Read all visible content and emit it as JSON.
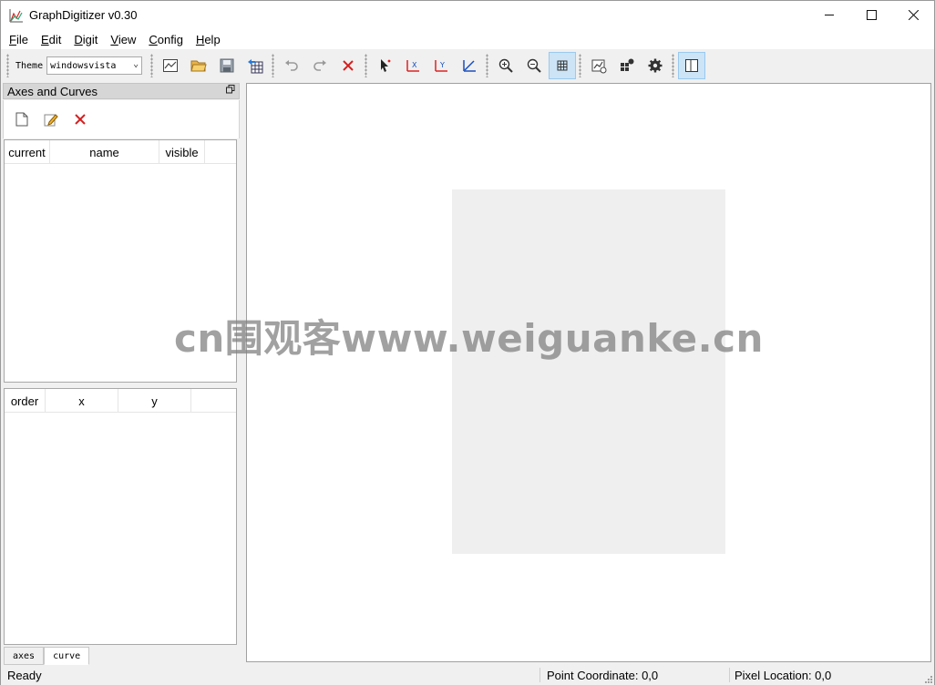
{
  "window": {
    "title": "GraphDigitizer v0.30",
    "controls": {
      "minimize": "—",
      "maximize": "☐",
      "close": "✕"
    }
  },
  "menu": {
    "items": [
      {
        "label": "File",
        "mnemonic": "F",
        "rest": "ile"
      },
      {
        "label": "Edit",
        "mnemonic": "E",
        "rest": "dit"
      },
      {
        "label": "Digit",
        "mnemonic": "D",
        "rest": "igit"
      },
      {
        "label": "View",
        "mnemonic": "V",
        "rest": "iew"
      },
      {
        "label": "Config",
        "mnemonic": "C",
        "rest": "onfig"
      },
      {
        "label": "Help",
        "mnemonic": "H",
        "rest": "elp"
      }
    ]
  },
  "toolbar": {
    "theme_label": "Theme",
    "theme_value": "windowsvista",
    "buttons": [
      {
        "icon": "graph-new-icon"
      },
      {
        "icon": "folder-open-icon"
      },
      {
        "icon": "save-icon"
      },
      {
        "icon": "export-table-icon"
      },
      {
        "icon": "undo-icon"
      },
      {
        "icon": "redo-icon"
      },
      {
        "icon": "delete-icon"
      },
      {
        "icon": "select-pointer-icon"
      },
      {
        "icon": "axis-x-icon"
      },
      {
        "icon": "axis-y-icon"
      },
      {
        "icon": "axis-xy-icon"
      },
      {
        "icon": "zoom-in-icon"
      },
      {
        "icon": "zoom-out-icon"
      },
      {
        "icon": "grid-icon"
      },
      {
        "icon": "chart-settings-icon"
      },
      {
        "icon": "plugin-icon"
      },
      {
        "icon": "gear-icon"
      },
      {
        "icon": "panel-layout-icon"
      }
    ],
    "active_colors": {
      "background": "#cde4f7",
      "border": "#99c9ef"
    }
  },
  "dock": {
    "title": "Axes and Curves",
    "float_icon": "restore-icon",
    "tools": [
      "new-document-icon",
      "edit-pencil-icon",
      "delete-x-icon"
    ],
    "curves_table": {
      "columns": [
        "current",
        "name",
        "visible"
      ]
    },
    "points_table": {
      "columns": [
        "order",
        "x",
        "y"
      ]
    },
    "tabs": [
      {
        "label": "axes",
        "active": false
      },
      {
        "label": "curve",
        "active": true
      }
    ]
  },
  "canvas": {
    "watermark": "cn围观客www.weiguanke.cn",
    "page_color": "#efefef"
  },
  "status": {
    "ready": "Ready",
    "point_coordinate": "Point Coordinate: 0,0",
    "pixel_location": "Pixel Location: 0,0"
  }
}
